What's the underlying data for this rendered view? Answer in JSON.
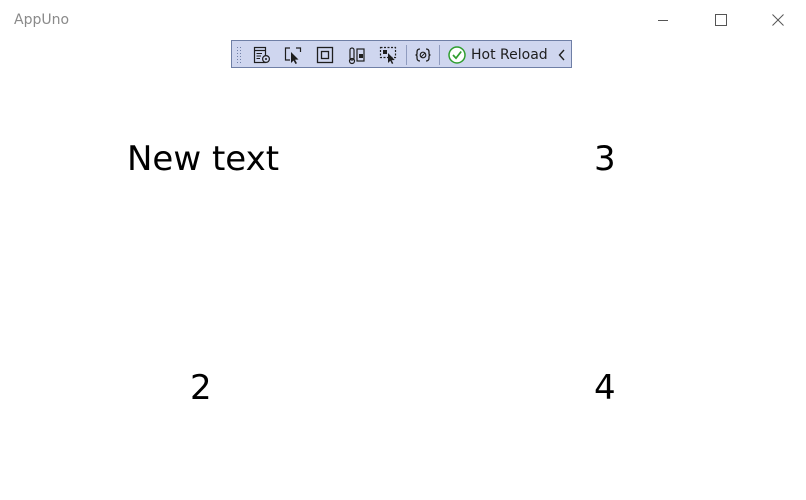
{
  "window": {
    "title": "AppUno"
  },
  "toolbar": {
    "hot_reload_label": "Hot Reload",
    "icons": [
      "live-property-explorer-icon",
      "select-element-icon",
      "display-layout-adorners-icon",
      "track-focus-icon",
      "select-element-hover-icon",
      "binding-failures-icon",
      "hot-reload-status-icon",
      "collapse-chevron-icon"
    ]
  },
  "content": {
    "cell1": "New text",
    "cell2": "2",
    "cell3": "3",
    "cell4": "4"
  },
  "colors": {
    "toolbar_bg": "#cfd6ef",
    "toolbar_border": "#6f7fa6",
    "hot_reload_check": "#2f9e2f"
  }
}
